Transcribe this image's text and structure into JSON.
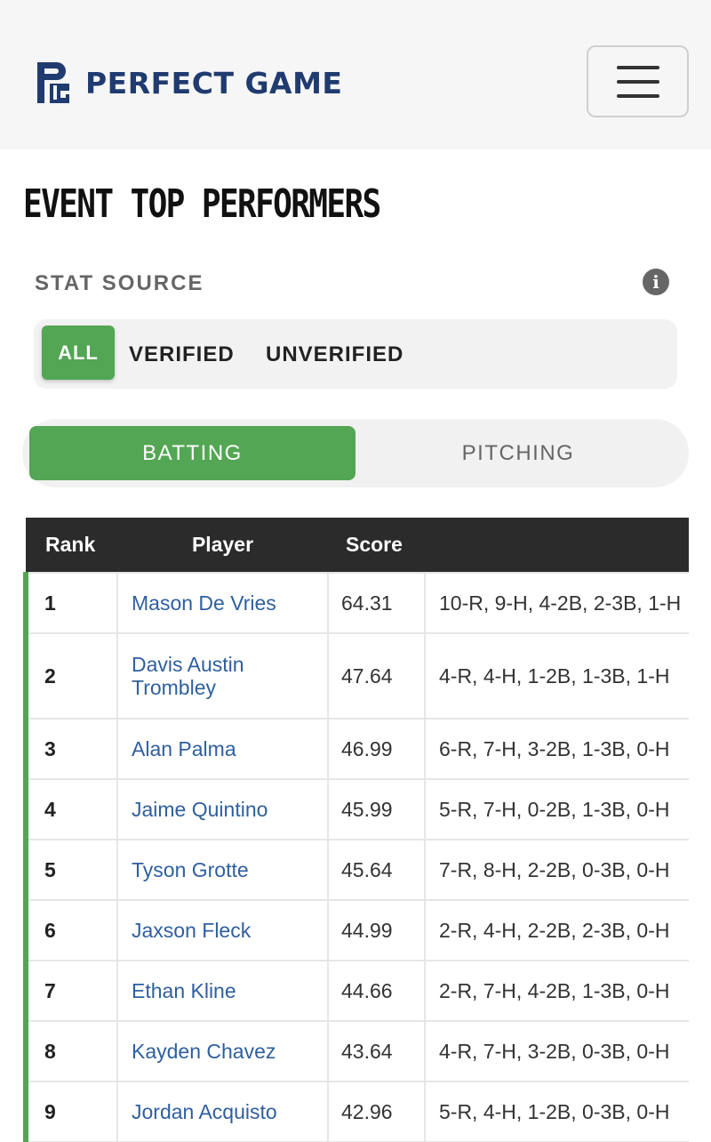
{
  "header": {
    "logo_text": "PERFECT GAME",
    "menu_icon": "hamburger-menu-icon",
    "brand_color": "#1f3b6f"
  },
  "page": {
    "title": "EVENT TOP PERFORMERS"
  },
  "stat_source": {
    "label": "STAT SOURCE",
    "info_icon": "info-icon",
    "options": [
      "ALL",
      "VERIFIED",
      "UNVERIFIED"
    ],
    "selected": "ALL"
  },
  "type_tabs": {
    "items": [
      "BATTING",
      "PITCHING"
    ],
    "selected": "BATTING",
    "accent_color": "#53a653"
  },
  "table": {
    "headers": [
      "Rank",
      "Player",
      "Score",
      ""
    ],
    "rows": [
      {
        "rank": "1",
        "player": "Mason De Vries",
        "score": "64.31",
        "stats": "10-R, 9-H, 4-2B, 2-3B, 1-H"
      },
      {
        "rank": "2",
        "player": "Davis Austin Trombley",
        "score": "47.64",
        "stats": "4-R, 4-H, 1-2B, 1-3B, 1-H"
      },
      {
        "rank": "3",
        "player": "Alan Palma",
        "score": "46.99",
        "stats": "6-R, 7-H, 3-2B, 1-3B, 0-H"
      },
      {
        "rank": "4",
        "player": "Jaime Quintino",
        "score": "45.99",
        "stats": "5-R, 7-H, 0-2B, 1-3B, 0-H"
      },
      {
        "rank": "5",
        "player": "Tyson Grotte",
        "score": "45.64",
        "stats": "7-R, 8-H, 2-2B, 0-3B, 0-H"
      },
      {
        "rank": "6",
        "player": "Jaxson Fleck",
        "score": "44.99",
        "stats": "2-R, 4-H, 2-2B, 2-3B, 0-H"
      },
      {
        "rank": "7",
        "player": "Ethan Kline",
        "score": "44.66",
        "stats": "2-R, 7-H, 4-2B, 1-3B, 0-H"
      },
      {
        "rank": "8",
        "player": "Kayden Chavez",
        "score": "43.64",
        "stats": "4-R, 7-H, 3-2B, 0-3B, 0-H"
      },
      {
        "rank": "9",
        "player": "Jordan Acquisto",
        "score": "42.96",
        "stats": "5-R, 4-H, 1-2B, 0-3B, 0-H"
      }
    ]
  }
}
